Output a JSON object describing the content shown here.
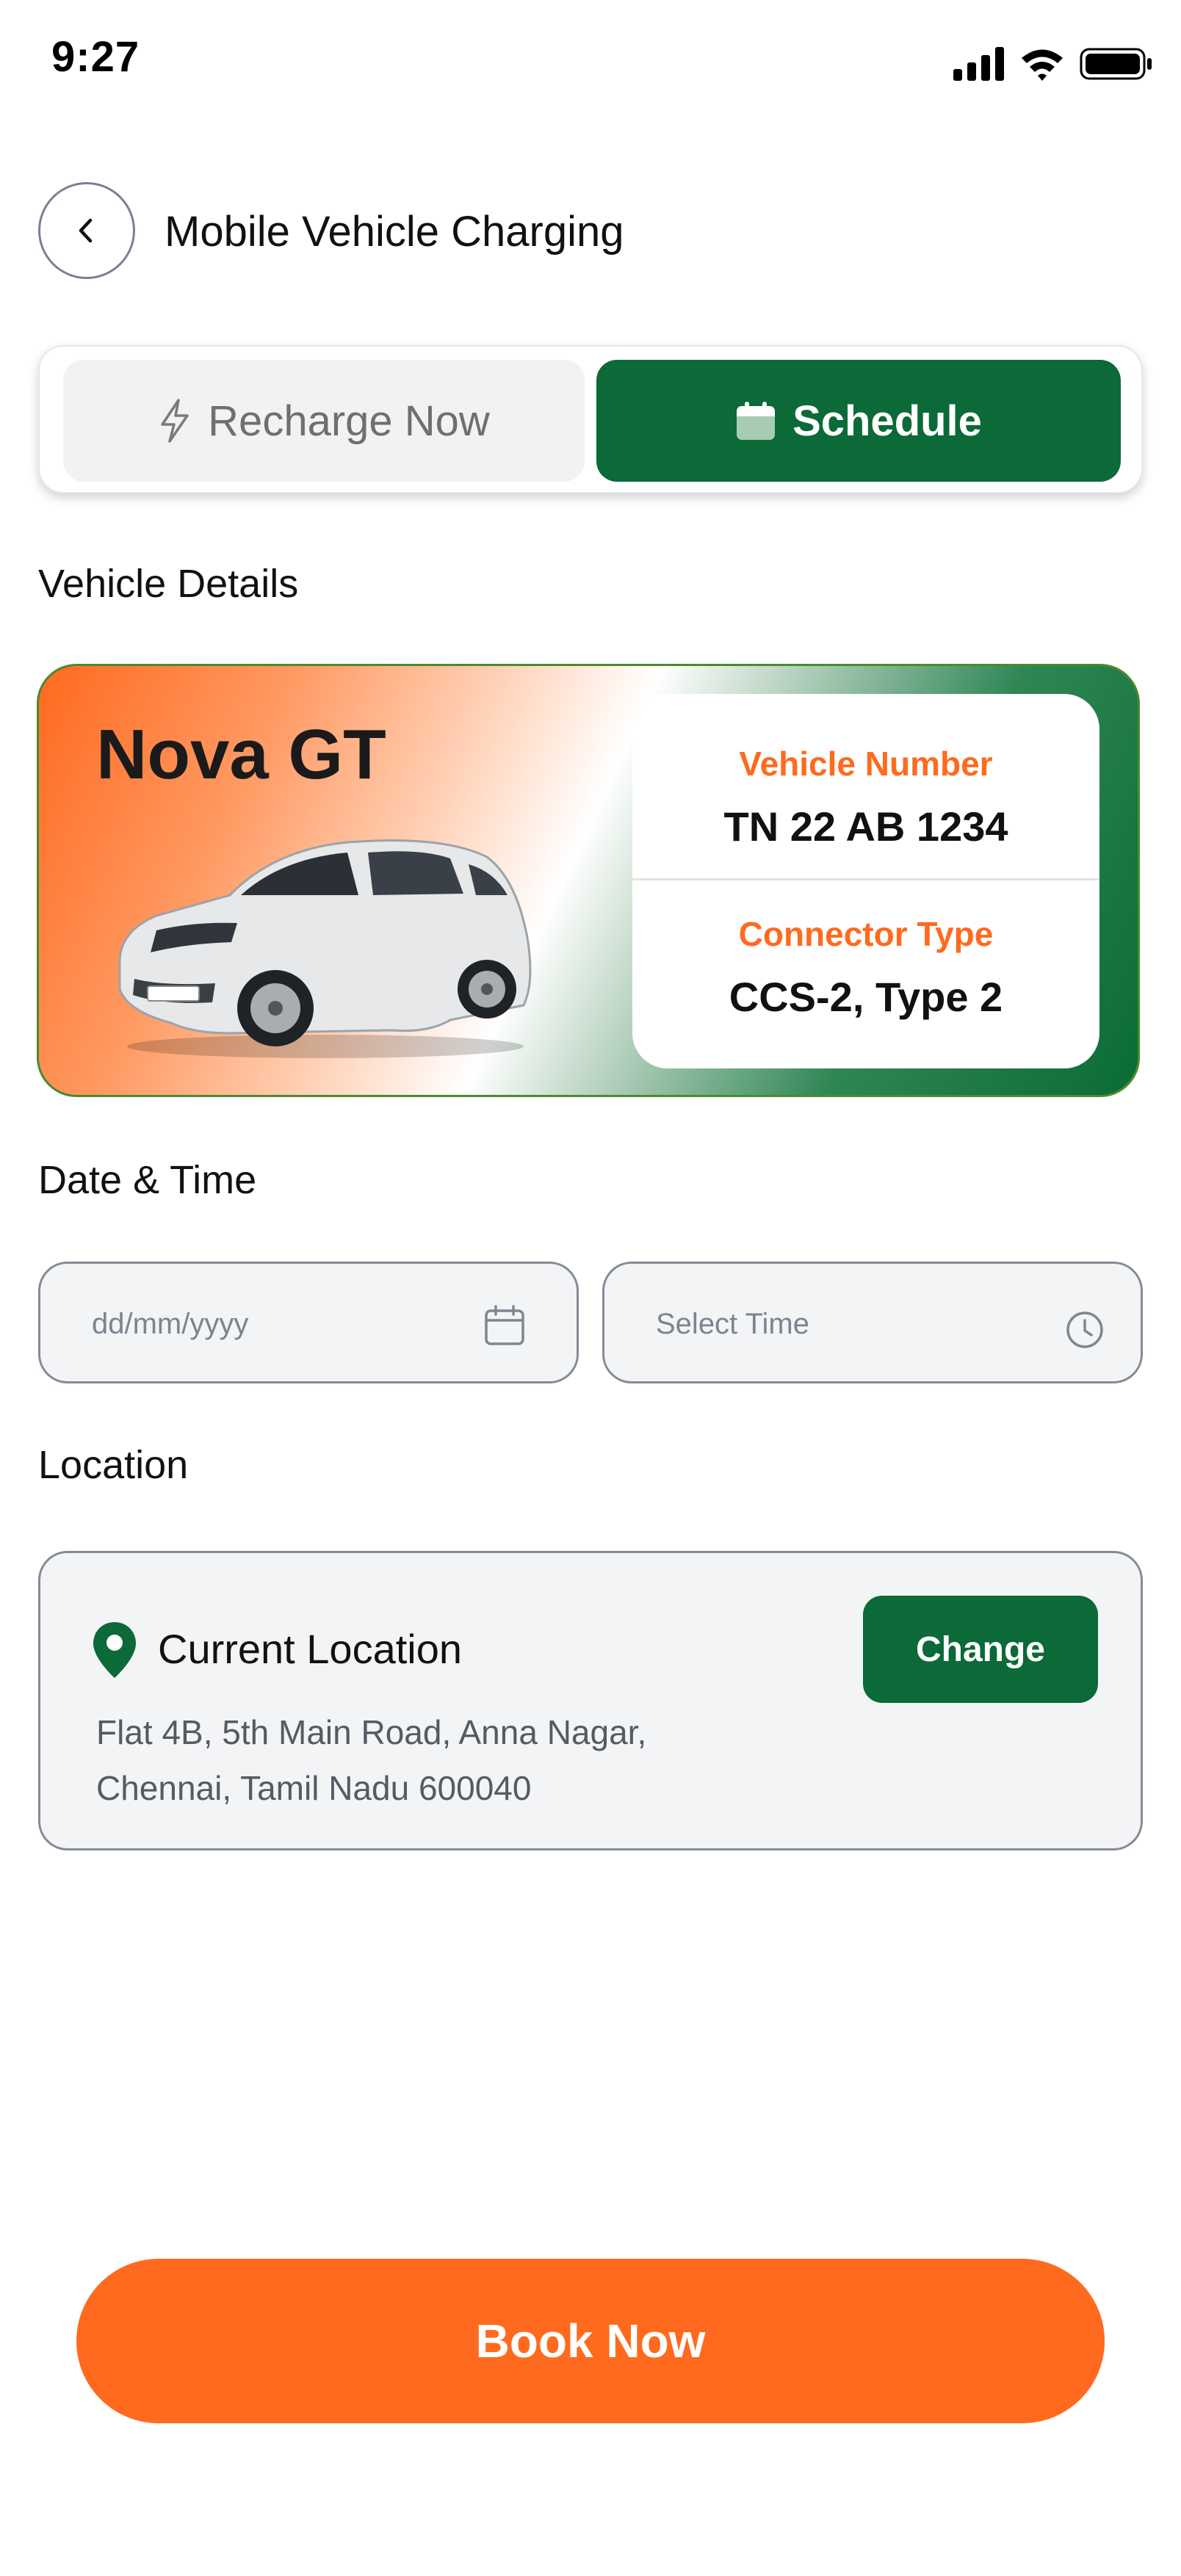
{
  "status_bar": {
    "time": "9:27",
    "icons": [
      "signal-icon",
      "wifi-icon",
      "battery-icon"
    ]
  },
  "header": {
    "back_icon": "chevron-left-icon",
    "title": "Mobile Vehicle Charging"
  },
  "mode_toggle": {
    "recharge_now": {
      "label": "Recharge Now",
      "icon": "lightning-icon",
      "selected": false
    },
    "schedule": {
      "label": "Schedule",
      "icon": "calendar-icon",
      "selected": true
    }
  },
  "vehicle_details": {
    "section_label": "Vehicle Details",
    "car_name": "Nova GT",
    "vehicle_number_label": "Vehicle Number",
    "vehicle_number": "TN 22 AB 1234",
    "connector_type_label": "Connector Type",
    "connector_type": "CCS-2, Type 2"
  },
  "date_time": {
    "section_label": "Date & Time",
    "date_placeholder": "dd/mm/yyyy",
    "date_value": "",
    "time_placeholder": "Select Time",
    "time_value": ""
  },
  "location": {
    "section_label": "Location",
    "title": "Current Location",
    "address_line1": "Flat 4B, 5th Main Road, Anna Nagar,",
    "address_line2": "Chennai, Tamil Nadu 600040",
    "change_label": "Change"
  },
  "book_button": {
    "label": "Book Now"
  },
  "colors": {
    "brand_green": "#0b6a37",
    "brand_orange": "#ff6a1f",
    "field_background": "#f3f4f6",
    "field_border": "#858a96"
  }
}
